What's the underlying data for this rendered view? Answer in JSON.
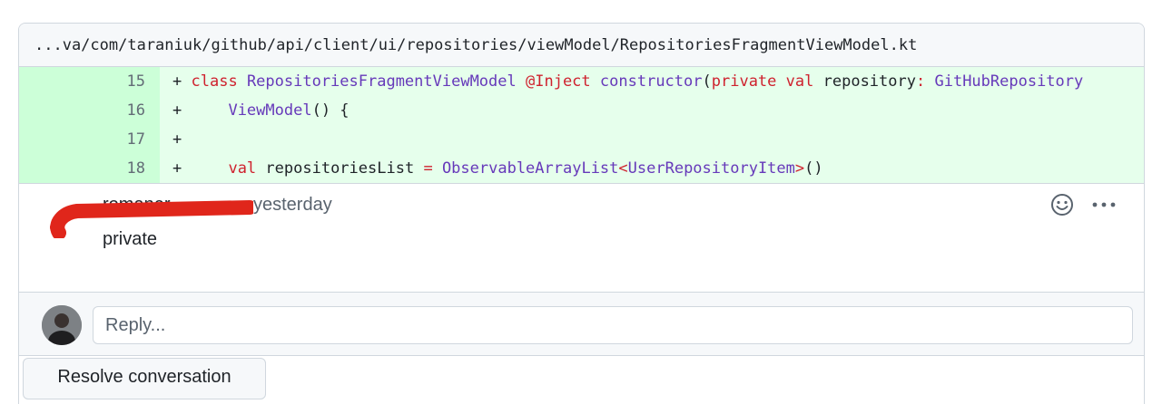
{
  "file": {
    "path": "...va/com/taraniuk/github/api/client/ui/repositories/viewModel/RepositoriesFragmentViewModel.kt"
  },
  "diff": {
    "line_numbers": [
      "15",
      "16",
      "17",
      "18"
    ],
    "lines": [
      {
        "marker": "+",
        "kw_class": "class",
        "class_name": "RepositoriesFragmentViewModel",
        "annotation": "@Inject",
        "ctor": "constructor",
        "paren_open": "(",
        "kw_private": "private",
        "kw_val": "val",
        "param": "repository",
        "colon": ":",
        "type": "GitHubRepository"
      },
      {
        "marker": "+",
        "indent": "    ",
        "type": "ViewModel",
        "rest": "() {"
      },
      {
        "marker": "+"
      },
      {
        "marker": "+",
        "indent": "    ",
        "kw_val": "val",
        "name": "repositoriesList",
        "eq": "=",
        "type": "ObservableArrayList",
        "lt": "<",
        "generic": "UserRepositoryItem",
        "gt": ">",
        "rest": "()"
      }
    ]
  },
  "comment": {
    "author": "romaner",
    "time": "yesterday",
    "body": "private"
  },
  "reply": {
    "placeholder": "Reply..."
  },
  "resolve": {
    "label": "Resolve conversation"
  },
  "colors": {
    "added_line_bg": "#e6ffec",
    "added_gutter_bg": "#ccffd8",
    "keyword": "#cf222e",
    "type": "#6639ba",
    "redaction": "#e0261b"
  },
  "icons": [
    "smiley-icon",
    "kebab-menu-icon",
    "user-avatar"
  ]
}
